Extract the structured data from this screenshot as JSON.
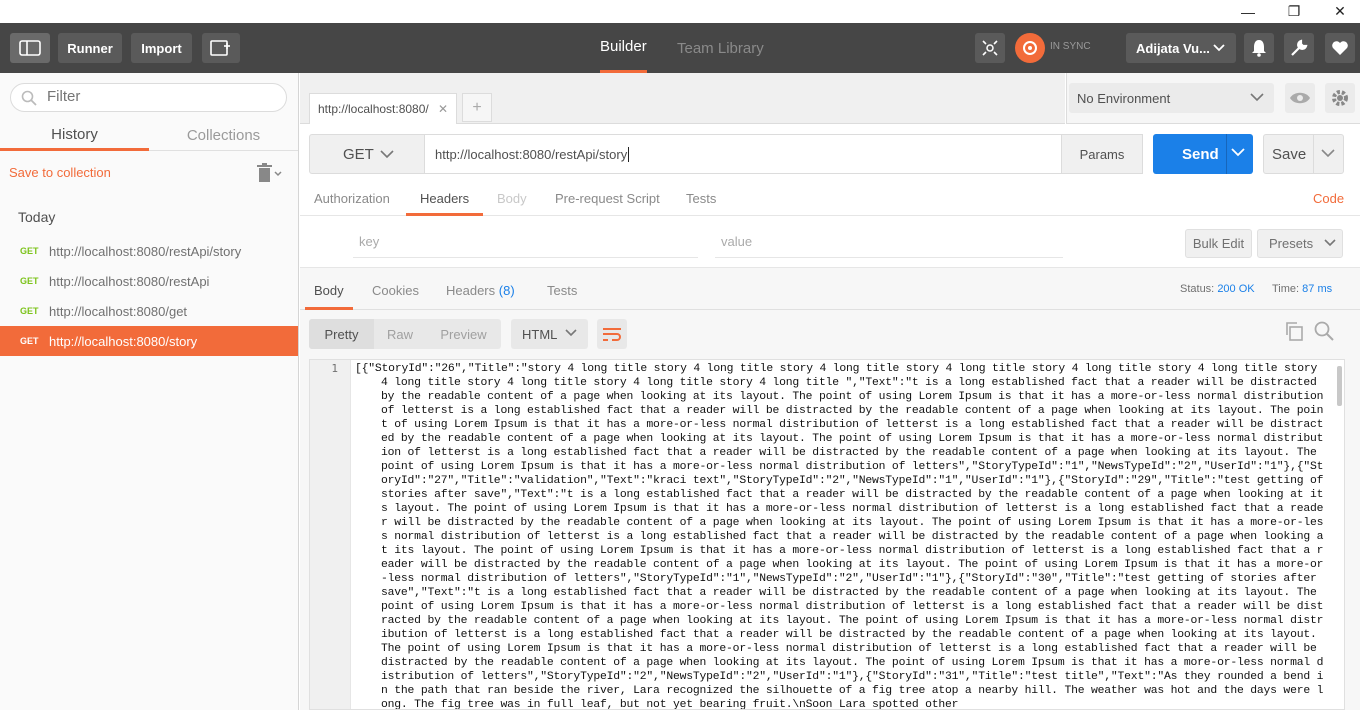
{
  "window": {
    "minimize": "—",
    "restore": "❐",
    "close": "✕"
  },
  "toolbar": {
    "runner": "Runner",
    "import": "Import",
    "tabs": [
      "Builder",
      "Team Library"
    ],
    "sync_status": "IN SYNC",
    "user": "Adijata Vu..."
  },
  "sidebar": {
    "filter_placeholder": "Filter",
    "tabs": [
      "History",
      "Collections"
    ],
    "save_to_collection": "Save to collection",
    "group_label": "Today",
    "history": [
      {
        "method": "GET",
        "url": "http://localhost:8080/restApi/story"
      },
      {
        "method": "GET",
        "url": "http://localhost:8080/restApi"
      },
      {
        "method": "GET",
        "url": "http://localhost:8080/get"
      },
      {
        "method": "GET",
        "url": "http://localhost:8080/story"
      }
    ]
  },
  "request": {
    "tab_title": "http://localhost:8080/",
    "environment": "No Environment",
    "method": "GET",
    "url": "http://localhost:8080/restApi/story",
    "params": "Params",
    "send": "Send",
    "save": "Save",
    "tabs": [
      "Authorization",
      "Headers",
      "Body",
      "Pre-request Script",
      "Tests"
    ],
    "code": "Code",
    "key_placeholder": "key",
    "value_placeholder": "value",
    "bulk_edit": "Bulk Edit",
    "presets": "Presets"
  },
  "response": {
    "tabs": [
      "Body",
      "Cookies",
      "Headers",
      "Tests"
    ],
    "headers_count": "(8)",
    "status_label": "Status:",
    "status_value": "200 OK",
    "time_label": "Time:",
    "time_value": "87 ms",
    "formats": [
      "Pretty",
      "Raw",
      "Preview"
    ],
    "language": "HTML",
    "line_number": "1",
    "body": "[{\"StoryId\":\"26\",\"Title\":\"story 4 long title story 4 long title story 4 long title story 4 long title story 4 long title story 4 long title story 4 long title story 4 long title story 4 long title story 4 long title \",\"Text\":\"t is a long established fact that a reader will be distracted by the readable content of a page when looking at its layout. The point of using Lorem Ipsum is that it has a more-or-less normal distribution of letterst is a long established fact that a reader will be distracted by the readable content of a page when looking at its layout. The point of using Lorem Ipsum is that it has a more-or-less normal distribution of letterst is a long established fact that a reader will be distracted by the readable content of a page when looking at its layout. The point of using Lorem Ipsum is that it has a more-or-less normal distribution of letterst is a long established fact that a reader will be distracted by the readable content of a page when looking at its layout. The point of using Lorem Ipsum is that it has a more-or-less normal distribution of letters\",\"StoryTypeId\":\"1\",\"NewsTypeId\":\"2\",\"UserId\":\"1\"},{\"StoryId\":\"27\",\"Title\":\"validation\",\"Text\":\"kraci text\",\"StoryTypeId\":\"2\",\"NewsTypeId\":\"1\",\"UserId\":\"1\"},{\"StoryId\":\"29\",\"Title\":\"test getting of stories after save\",\"Text\":\"t is a long established fact that a reader will be distracted by the readable content of a page when looking at its layout. The point of using Lorem Ipsum is that it has a more-or-less normal distribution of letterst is a long established fact that a reader will be distracted by the readable content of a page when looking at its layout. The point of using Lorem Ipsum is that it has a more-or-less normal distribution of letterst is a long established fact that a reader will be distracted by the readable content of a page when looking at its layout. The point of using Lorem Ipsum is that it has a more-or-less normal distribution of letterst is a long established fact that a reader will be distracted by the readable content of a page when looking at its layout. The point of using Lorem Ipsum is that it has a more-or-less normal distribution of letters\",\"StoryTypeId\":\"1\",\"NewsTypeId\":\"2\",\"UserId\":\"1\"},{\"StoryId\":\"30\",\"Title\":\"test getting of stories after save\",\"Text\":\"t is a long established fact that a reader will be distracted by the readable content of a page when looking at its layout. The point of using Lorem Ipsum is that it has a more-or-less normal distribution of letterst is a long established fact that a reader will be distracted by the readable content of a page when looking at its layout. The point of using Lorem Ipsum is that it has a more-or-less normal distribution of letterst is a long established fact that a reader will be distracted by the readable content of a page when looking at its layout. The point of using Lorem Ipsum is that it has a more-or-less normal distribution of letterst is a long established fact that a reader will be distracted by the readable content of a page when looking at its layout. The point of using Lorem Ipsum is that it has a more-or-less normal distribution of letters\",\"StoryTypeId\":\"2\",\"NewsTypeId\":\"2\",\"UserId\":\"1\"},{\"StoryId\":\"31\",\"Title\":\"test title\",\"Text\":\"As they rounded a bend in the path that ran beside the river, Lara recognized the silhouette of a fig tree atop a nearby hill. The weather was hot and the days were long. The fig tree was in full leaf, but not yet bearing fruit.\\nSoon Lara spotted other"
  }
}
